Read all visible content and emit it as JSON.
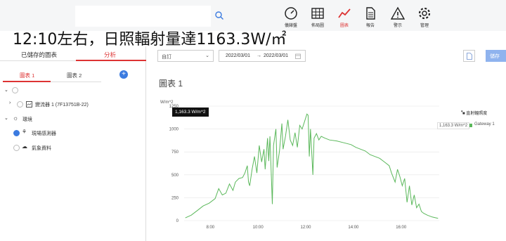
{
  "headline": "12:10左右，日照輻射量達1163.3W/㎡",
  "nav": [
    {
      "label": "儀錶盤",
      "icon": "gauge-icon",
      "active": false
    },
    {
      "label": "佈局圖",
      "icon": "grid-icon",
      "active": false
    },
    {
      "label": "圖表",
      "icon": "chart-line-icon",
      "active": true
    },
    {
      "label": "報告",
      "icon": "document-icon",
      "active": false
    },
    {
      "label": "警示",
      "icon": "warning-icon",
      "active": false
    },
    {
      "label": "管理",
      "icon": "gear-icon",
      "active": false
    }
  ],
  "left_panel": {
    "tabs": {
      "saved": "已儲存的圖表",
      "analysis": "分析"
    },
    "subtabs": {
      "chart1": "圖表 1",
      "chart2": "圖表 2"
    },
    "add_button": "+",
    "tree": {
      "inverter": "變流器 1 (7F13751B-22)",
      "environment": "環境",
      "site_sensor": "現場感測器",
      "weather": "氣象資料"
    }
  },
  "toolbar": {
    "range_select": "自訂",
    "date_from": "2022/03/01",
    "date_arrow": "→",
    "date_to": "2022/03/01",
    "save_label": "儲存"
  },
  "chart_title": "圖表 1",
  "tooltip": "1,163.3 W/m^2",
  "legend": {
    "title": "直射輻照度",
    "series": "Gateway 1",
    "value": "1,163.3 W/m^2"
  },
  "colors": {
    "accent": "#d33333",
    "series": "#5bb85b",
    "primary": "#3b7be0"
  },
  "chart_data": {
    "type": "line",
    "ylabel": "W/m^2",
    "ylim": [
      0,
      1250
    ],
    "yticks": [
      "0",
      "250",
      "500",
      "750",
      "1000",
      "1250"
    ],
    "xticks": [
      "8:00",
      "10:00",
      "12:00",
      "14:00",
      "16:00"
    ],
    "series": [
      {
        "name": "Gateway 1",
        "x": [
          6.95,
          7.2,
          7.45,
          7.7,
          7.95,
          8.2,
          8.35,
          8.5,
          8.65,
          8.8,
          8.95,
          9.05,
          9.2,
          9.35,
          9.45,
          9.55,
          9.6,
          9.65,
          9.75,
          9.85,
          9.95,
          10.05,
          10.15,
          10.25,
          10.3,
          10.4,
          10.45,
          10.5,
          10.6,
          10.65,
          10.75,
          10.8,
          10.9,
          11.0,
          11.05,
          11.15,
          11.25,
          11.35,
          11.45,
          11.55,
          11.65,
          11.75,
          11.85,
          11.95,
          12.05,
          12.1,
          12.15,
          12.2,
          12.3,
          12.35,
          12.45,
          12.55,
          12.65,
          12.8,
          13.0,
          13.3,
          13.6,
          13.9,
          14.1,
          14.3,
          14.5,
          14.7,
          14.9,
          15.1,
          15.3,
          15.5,
          15.6,
          15.75,
          15.85,
          15.95,
          16.05,
          16.15,
          16.25,
          16.35,
          16.45,
          16.55,
          16.65,
          16.75,
          16.85,
          16.95,
          17.1,
          17.3,
          17.55
        ],
        "y": [
          30,
          60,
          110,
          160,
          190,
          240,
          350,
          280,
          300,
          400,
          330,
          420,
          460,
          470,
          520,
          600,
          420,
          380,
          560,
          700,
          520,
          820,
          640,
          780,
          560,
          900,
          650,
          920,
          180,
          820,
          1000,
          580,
          760,
          1060,
          780,
          920,
          1100,
          880,
          820,
          960,
          800,
          1040,
          1000,
          1080,
          1163.3,
          1150,
          700,
          1000,
          500,
          900,
          950,
          880,
          920,
          900,
          880,
          870,
          850,
          830,
          800,
          780,
          760,
          720,
          700,
          680,
          640,
          600,
          520,
          420,
          560,
          480,
          380,
          460,
          200,
          380,
          170,
          280,
          140,
          180,
          100,
          80,
          60,
          40,
          25
        ]
      }
    ]
  }
}
